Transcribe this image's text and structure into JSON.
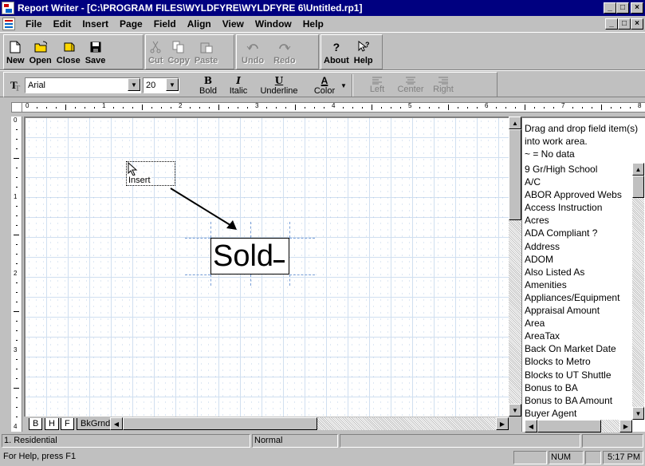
{
  "window": {
    "title": "Report Writer - [C:\\PROGRAM FILES\\WYLDFYRE\\WYLDFYRE 6\\Untitled.rp1]",
    "controls": {
      "minimize": "_",
      "maximize": "□",
      "close": "×"
    }
  },
  "menu": {
    "items": [
      "File",
      "Edit",
      "Insert",
      "Page",
      "Field",
      "Align",
      "View",
      "Window",
      "Help"
    ]
  },
  "toolbar": {
    "new": "New",
    "open": "Open",
    "close": "Close",
    "save": "Save",
    "cut": "Cut",
    "copy": "Copy",
    "paste": "Paste",
    "undo": "Undo",
    "redo": "Redo",
    "about": "About",
    "help": "Help"
  },
  "format_bar": {
    "font_value": "Arial",
    "size_value": "20",
    "bold": "Bold",
    "bold_glyph": "B",
    "italic": "Italic",
    "italic_glyph": "I",
    "underline": "Underline",
    "underline_glyph": "U",
    "color": "Color",
    "color_glyph": "A",
    "left": "Left",
    "center": "Center",
    "right": "Right"
  },
  "ruler": {
    "h_marks": [
      "0",
      "1",
      "2",
      "3",
      "4",
      "5",
      "6",
      "7",
      "8"
    ],
    "v_marks": [
      "0",
      "1",
      "2",
      "3",
      "4"
    ]
  },
  "canvas": {
    "insert_label": "Insert",
    "field_text": "Sold"
  },
  "tabs": [
    "B",
    "H",
    "F",
    "BkGrnd"
  ],
  "field_panel": {
    "hint": "Drag and drop field item(s) into work area.",
    "no_data": "~ = No data",
    "items": [
      "9 Gr/High School",
      "A/C",
      "ABOR Approved Webs",
      "Access Instruction",
      "Acres",
      "ADA Compliant ?",
      "Address",
      "ADOM",
      "Also Listed As",
      "Amenities",
      "Appliances/Equipment",
      "Appraisal Amount",
      "Area",
      "AreaTax",
      "Back On Market Date",
      "Blocks to Metro",
      "Blocks to UT Shuttle",
      "Bonus to BA",
      "Bonus to BA Amount",
      "Buyer Agent"
    ]
  },
  "status": {
    "section": "1. Residential",
    "mode": "Normal",
    "help": "For Help, press F1",
    "num": "NUM",
    "time": "5:17 PM"
  }
}
